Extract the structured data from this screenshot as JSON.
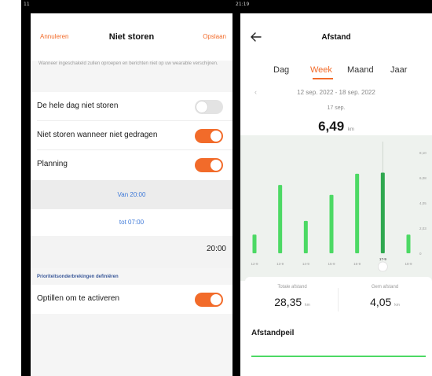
{
  "left": {
    "status_text": "11",
    "nav": {
      "cancel": "Annuleren",
      "title": "Niet storen",
      "save": "Opslaan"
    },
    "description": "Wanneer ingeschakeld zullen oproepen en berichten niet op uw wearable verschijnen.",
    "rows": [
      {
        "label": "De hele dag niet storen",
        "on": false
      },
      {
        "label": "Niet storen wanneer niet gedragen",
        "on": true
      },
      {
        "label": "Planning",
        "on": true
      }
    ],
    "schedule": {
      "from": "Van 20:00",
      "to": "tot 07:00",
      "time_value": "20:00"
    },
    "priority_header": "Prioriteitsonderbrekingen definiëren",
    "lift_row": {
      "label": "Optillen om te activeren",
      "on": true
    }
  },
  "right": {
    "status_text": "21:19",
    "title": "Afstand",
    "tabs": [
      "Dag",
      "Week",
      "Maand",
      "Jaar"
    ],
    "active_tab": "Week",
    "date_range": "12 sep. 2022 - 18 sep. 2022",
    "selected": {
      "date": "17 sep.",
      "value": "6,49",
      "unit": "km"
    },
    "stats": [
      {
        "label": "Totale afstand",
        "value": "28,35",
        "unit": "km"
      },
      {
        "label": "Gem afstand",
        "value": "4,05",
        "unit": "km"
      }
    ],
    "section_title": "Afstandpeil",
    "colors": {
      "accent": "#f26b2a",
      "bar": "#4cd964",
      "bar_selected": "#2fa84f"
    }
  },
  "chart_data": {
    "type": "bar",
    "categories": [
      "12-9",
      "13-9",
      "14-9",
      "15-9",
      "16-9",
      "17-9",
      "18-9"
    ],
    "values": [
      1.5,
      5.5,
      2.6,
      4.7,
      6.4,
      6.49,
      1.5
    ],
    "selected_index": 5,
    "y_ticks": [
      "0",
      "2,03",
      "4,05",
      "6,08",
      "8,10"
    ],
    "ylim": [
      0,
      8.1
    ],
    "grid": false
  }
}
